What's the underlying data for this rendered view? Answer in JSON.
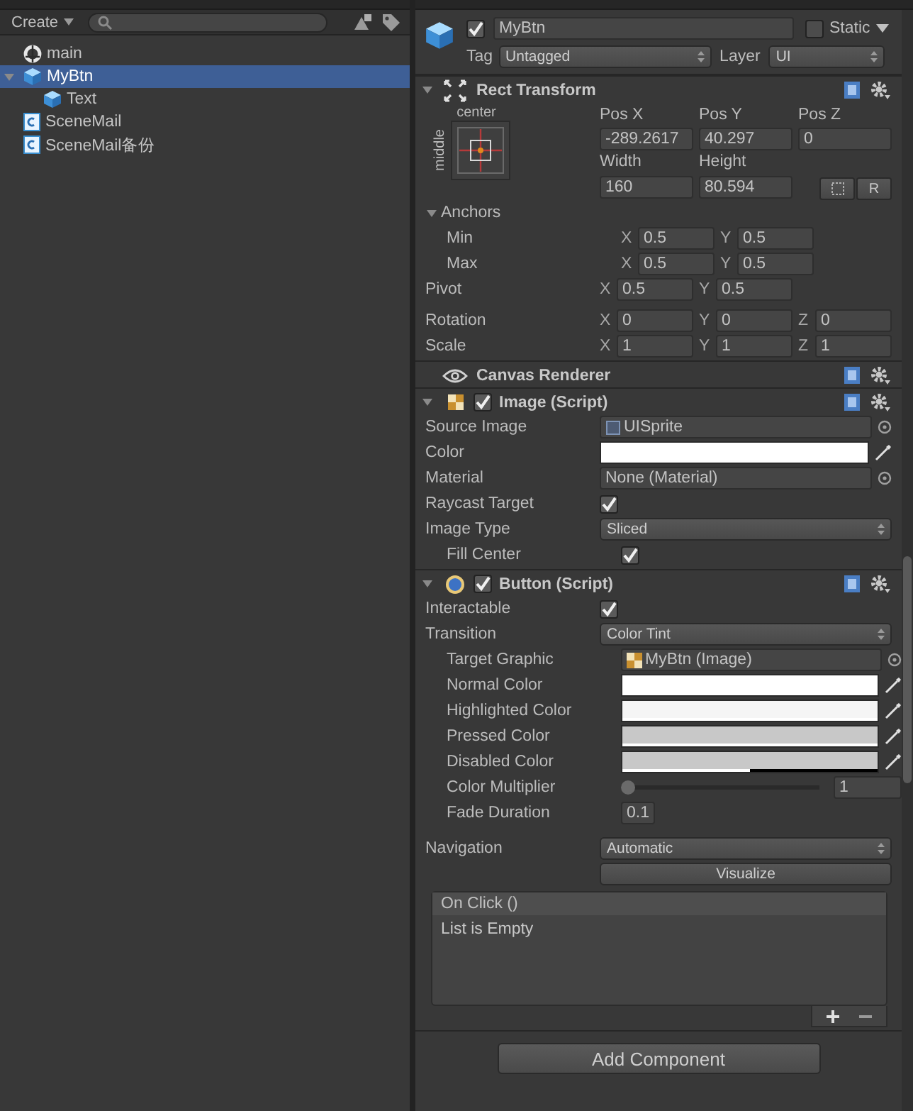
{
  "project": {
    "create_label": "Create",
    "items": [
      {
        "label": "main",
        "kind": "scene",
        "selected": false
      },
      {
        "label": "MyBtn",
        "kind": "prefab",
        "selected": true,
        "expanded": true,
        "children": [
          {
            "label": "Text",
            "kind": "prefab",
            "selected": false
          }
        ]
      },
      {
        "label": "SceneMail",
        "kind": "script",
        "selected": false
      },
      {
        "label": "SceneMail备份",
        "kind": "script",
        "selected": false
      }
    ]
  },
  "inspector": {
    "header": {
      "active": true,
      "name": "MyBtn",
      "static": false,
      "static_label": "Static",
      "tag_label": "Tag",
      "tag": "Untagged",
      "layer_label": "Layer",
      "layer": "UI"
    },
    "rect_transform": {
      "title": "Rect Transform",
      "expanded": true,
      "anchor": {
        "horizontal": "center",
        "vertical": "middle"
      },
      "position": [
        {
          "label": "Pos X",
          "value": "-289.2617"
        },
        {
          "label": "Pos Y",
          "value": "40.297"
        },
        {
          "label": "Pos Z",
          "value": "0"
        }
      ],
      "size": [
        {
          "label": "Width",
          "value": "160"
        },
        {
          "label": "Height",
          "value": "80.594"
        }
      ],
      "raw_button": "R",
      "anchor_rows": [
        {
          "kind": "group",
          "label": "Anchors",
          "expanded": true,
          "children": [
            {
              "kind": "vector",
              "label": "Min",
              "axes": [
                {
                  "axis": "X",
                  "value": "0.5"
                },
                {
                  "axis": "Y",
                  "value": "0.5"
                }
              ]
            },
            {
              "kind": "vector",
              "label": "Max",
              "axes": [
                {
                  "axis": "X",
                  "value": "0.5"
                },
                {
                  "axis": "Y",
                  "value": "0.5"
                }
              ]
            }
          ]
        },
        {
          "kind": "vector",
          "label": "Pivot",
          "axes": [
            {
              "axis": "X",
              "value": "0.5"
            },
            {
              "axis": "Y",
              "value": "0.5"
            }
          ]
        }
      ],
      "transform_rows": [
        {
          "kind": "vector",
          "label": "Rotation",
          "axes": [
            {
              "axis": "X",
              "value": "0"
            },
            {
              "axis": "Y",
              "value": "0"
            },
            {
              "axis": "Z",
              "value": "0"
            }
          ]
        },
        {
          "kind": "vector",
          "label": "Scale",
          "axes": [
            {
              "axis": "X",
              "value": "1"
            },
            {
              "axis": "Y",
              "value": "1"
            },
            {
              "axis": "Z",
              "value": "1"
            }
          ]
        }
      ]
    },
    "components": [
      {
        "title": "Canvas Renderer",
        "kind": "eye"
      },
      {
        "title": "Image (Script)",
        "kind": "image",
        "enabled": true,
        "expanded": true,
        "rows": [
          {
            "kind": "sprite_object",
            "label": "Source Image",
            "value": "UISprite"
          },
          {
            "kind": "color",
            "label": "Color",
            "color": "#ffffff",
            "level": 1
          },
          {
            "kind": "object",
            "label": "Material",
            "value": "None (Material)"
          },
          {
            "kind": "checkbox",
            "label": "Raycast Target",
            "checked": true
          },
          {
            "kind": "dropdown",
            "label": "Image Type",
            "value": "Sliced",
            "children": [
              {
                "kind": "checkbox",
                "label": "Fill Center",
                "checked": true
              }
            ]
          }
        ]
      },
      {
        "title": "Button (Script)",
        "kind": "button",
        "enabled": true,
        "expanded": true,
        "rows": [
          {
            "kind": "checkbox",
            "label": "Interactable",
            "checked": true
          },
          {
            "kind": "dropdown",
            "label": "Transition",
            "value": "Color Tint",
            "children": [
              {
                "kind": "image_object",
                "label": "Target Graphic",
                "value": "MyBtn (Image)"
              },
              {
                "kind": "color",
                "label": "Normal Color",
                "color": "#ffffff",
                "level": 1
              },
              {
                "kind": "color",
                "label": "Highlighted Color",
                "color": "#f5f5f5",
                "level": 1
              },
              {
                "kind": "color",
                "label": "Pressed Color",
                "color": "#c8c8c8",
                "level": 1
              },
              {
                "kind": "color",
                "label": "Disabled Color",
                "color": "#c8c8c8",
                "level": 0.5
              },
              {
                "kind": "slider",
                "label": "Color Multiplier",
                "level": 0,
                "reading": "1"
              },
              {
                "kind": "number",
                "label": "Fade Duration",
                "value": "0.1"
              }
            ]
          }
        ],
        "navigation": {
          "label": "Navigation",
          "value": "Automatic",
          "button": "Visualize"
        },
        "event": {
          "title": "On Click ()",
          "empty_text": "List is Empty"
        }
      }
    ],
    "add_component": "Add Component"
  }
}
